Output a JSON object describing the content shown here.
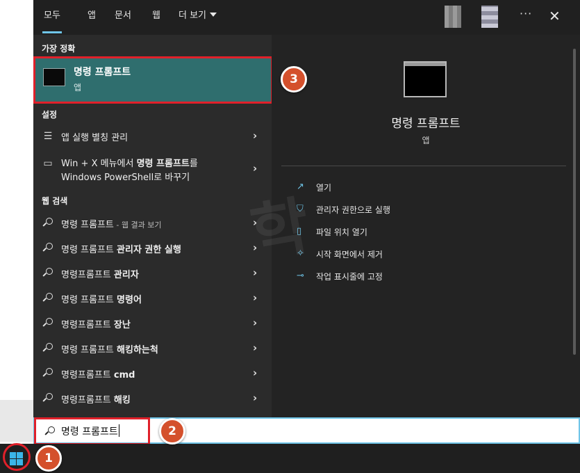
{
  "tabs": [
    {
      "label": "모두",
      "active": true
    },
    {
      "label": "앱"
    },
    {
      "label": "문서"
    },
    {
      "label": "웹"
    },
    {
      "label": "더 보기"
    }
  ],
  "topbar": {
    "more_options": "···",
    "close": "✕"
  },
  "best_match": {
    "section": "가장 정확",
    "title": "명령 프롬프트",
    "subtitle": "앱"
  },
  "settings": {
    "section": "설정",
    "items": [
      {
        "text": "앱 실행 별칭 관리",
        "icon": "list-settings-icon"
      },
      {
        "line1_a": "Win + X 메뉴에서 ",
        "line1_b": "명령 프롬프트",
        "line1_c": "를",
        "line2": "Windows PowerShell로 바꾸기",
        "icon": "monitor-icon"
      }
    ]
  },
  "web": {
    "section": "웹 검색",
    "items": [
      {
        "text": "명령 프롬프트",
        "sub": " - 웹 결과 보기"
      },
      {
        "text": "명령 프롬프트 ",
        "bold": "관리자 권한 실행"
      },
      {
        "text": "명령프롬프트 ",
        "bold": "관리자"
      },
      {
        "text": "명령 프롬프트 ",
        "bold": "명령어"
      },
      {
        "text": "명령프롬프트 ",
        "bold": "장난"
      },
      {
        "text": "명령 프롬프트 ",
        "bold": "해킹하는척"
      },
      {
        "text": "명령프롬프트 ",
        "bold": "cmd"
      },
      {
        "text": "명령프롬프트 ",
        "bold": "해킹"
      }
    ]
  },
  "preview": {
    "title": "명령 프롬프트",
    "subtitle": "앱",
    "actions": [
      {
        "label": "열기",
        "icon": "open-icon"
      },
      {
        "label": "관리자 권한으로 실행",
        "icon": "shield-icon"
      },
      {
        "label": "파일 위치 열기",
        "icon": "file-location-icon"
      },
      {
        "label": "시작 화면에서 제거",
        "icon": "unpin-icon"
      },
      {
        "label": "작업 표시줄에 고정",
        "icon": "pin-icon"
      }
    ]
  },
  "search": {
    "value": "명령 프롬프트"
  },
  "watermark": "학",
  "badges": {
    "step1": "1",
    "step2": "2",
    "step3": "3"
  },
  "colors": {
    "accent": "#6fc5e8",
    "highlight_red": "#e0202a",
    "best_match_bg": "#2f6e6e",
    "badge": "#d4502c"
  }
}
